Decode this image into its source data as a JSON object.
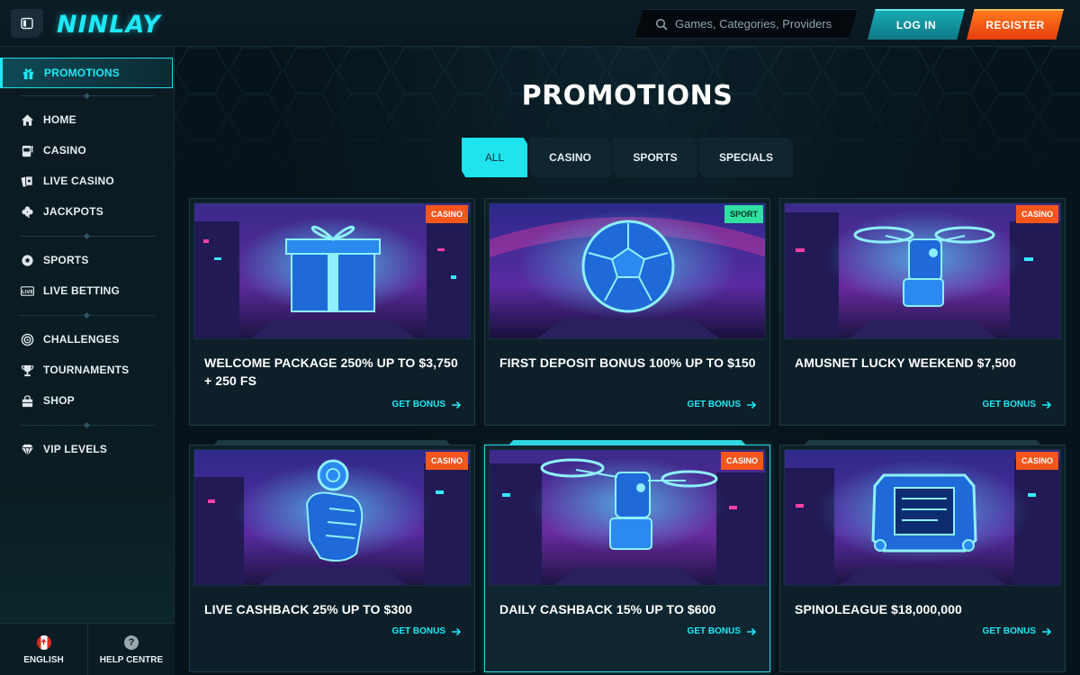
{
  "app": {
    "logo": "NINLAY",
    "search_placeholder": "Games, Categories, Providers",
    "login_label": "LOG IN",
    "register_label": "REGISTER"
  },
  "sidebar": {
    "active": {
      "label": "PROMOTIONS",
      "icon": "gift-icon"
    },
    "items": [
      {
        "label": "HOME",
        "icon": "home-icon"
      },
      {
        "label": "CASINO",
        "icon": "slot-machine-icon"
      },
      {
        "label": "LIVE CASINO",
        "icon": "cards-icon"
      },
      {
        "label": "JACKPOTS",
        "icon": "clover-icon"
      },
      {
        "label": "SPORTS",
        "icon": "soccer-ball-icon"
      },
      {
        "label": "LIVE BETTING",
        "icon": "live-icon"
      },
      {
        "label": "CHALLENGES",
        "icon": "target-icon"
      },
      {
        "label": "TOURNAMENTS",
        "icon": "trophy-icon"
      },
      {
        "label": "SHOP",
        "icon": "shop-bag-icon"
      },
      {
        "label": "VIP LEVELS",
        "icon": "diamond-icon"
      }
    ],
    "footer": {
      "language": "ENGLISH",
      "help": "HELP CENTRE",
      "help_glyph": "?"
    }
  },
  "main": {
    "title": "PROMOTIONS",
    "tabs": [
      {
        "label": "ALL",
        "active": true
      },
      {
        "label": "CASINO",
        "active": false
      },
      {
        "label": "SPORTS",
        "active": false
      },
      {
        "label": "SPECIALS",
        "active": false
      }
    ],
    "cta_label": "GET BONUS",
    "cards": [
      {
        "title": "WELCOME PACKAGE 250% UP TO $3,750 + 250 FS",
        "badge": "CASINO",
        "badge_type": "casino",
        "art": "gift-box"
      },
      {
        "title": "FIRST DEPOSIT BONUS 100% UP TO $150",
        "badge": "SPORT",
        "badge_type": "sport",
        "art": "soccer-ball"
      },
      {
        "title": "AMUSNET LUCKY WEEKEND $7,500",
        "badge": "CASINO",
        "badge_type": "casino",
        "art": "robot-drone"
      },
      {
        "title": "LIVE CASHBACK 25% UP TO $300",
        "badge": "CASINO",
        "badge_type": "casino",
        "art": "robot-hand-chip"
      },
      {
        "title": "DAILY CASHBACK 15% UP TO $600",
        "badge": "CASINO",
        "badge_type": "casino",
        "art": "robot-drone"
      },
      {
        "title": "SPINOLEAGUE $18,000,000",
        "badge": "CASINO",
        "badge_type": "casino",
        "art": "slot-device"
      }
    ]
  },
  "colors": {
    "accent": "#1ee8f5",
    "casino_badge": "#f4561c",
    "sport_badge": "#2fe0a0",
    "register": "#ff5a14",
    "background": "#07131a"
  }
}
